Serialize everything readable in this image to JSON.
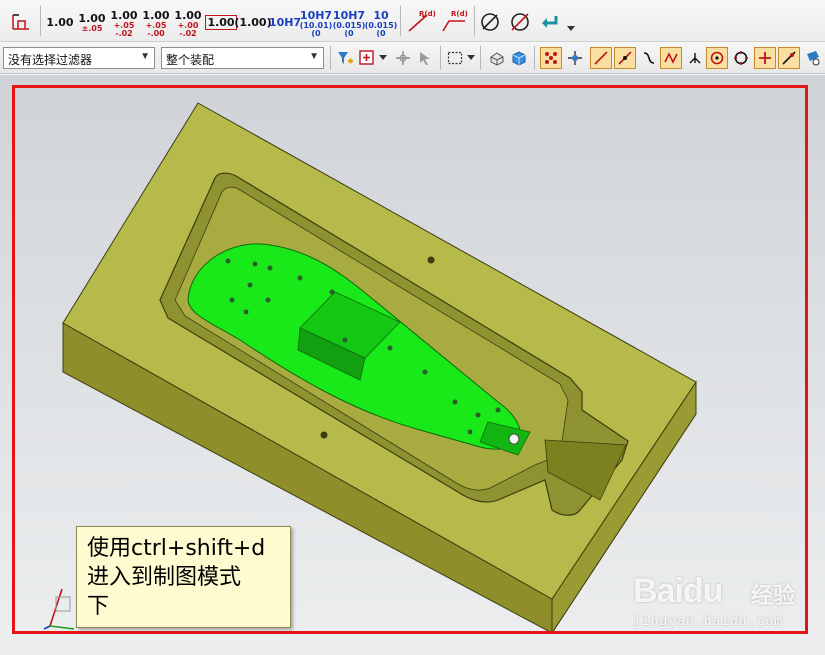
{
  "toolbar_dims": {
    "d1": "1.00",
    "d2": "1.00",
    "d2_tol": "±.05",
    "d3": "1.00",
    "d3_up": "+.05",
    "d3_dn": "-.02",
    "d4": "1.00",
    "d4_up": "+.05",
    "d4_dn": "-.00",
    "d5": "1.00",
    "d5_up": "+.00",
    "d5_dn": "-.02",
    "d6": "1.00",
    "d7": "(1.00)",
    "d8": "10H7",
    "d9": "10H7",
    "d9_a": "(10.01)",
    "d9_b": "(0",
    "d10": "10H7",
    "d10_a": "(0.015)",
    "d10_b": "(0",
    "d11": "10",
    "d11_a": "(0.015)",
    "d11_b": "(0",
    "r1": "R(d)",
    "r2": "R(d)"
  },
  "filters": {
    "selection_filter": "没有选择过滤器",
    "scope": "整个装配"
  },
  "callout": {
    "line1": "使用ctrl+shift+d",
    "line2": "进入到制图模式",
    "line3": "下"
  },
  "watermark": {
    "brand": "Baidu",
    "cn": "经验",
    "url": "jingyan.baidu.com"
  },
  "colors": {
    "mold": "#b6ba4a",
    "part": "#19e819",
    "frame": "#e31515",
    "callout_bg": "#fffbd0"
  }
}
